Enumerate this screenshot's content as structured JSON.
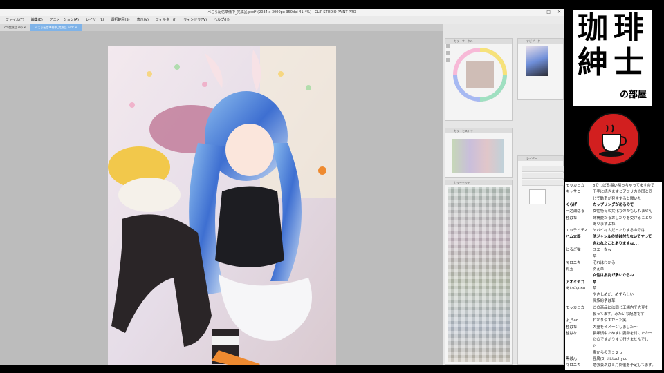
{
  "window": {
    "title": "ぺこら配信準備中_完成品.psd* (2034 x 3000px 350dpi 41.4%) - CLIP STUDIO PAINT PRO",
    "controls": [
      "—",
      "□",
      "✕"
    ]
  },
  "menu": [
    "ファイル(F)",
    "編集(E)",
    "アニメーション(A)",
    "レイヤー(L)",
    "選択範囲(S)",
    "表示(V)",
    "フィルター(I)",
    "ウィンドウ(W)",
    "ヘルプ(H)"
  ],
  "tabs": [
    {
      "label": "ccli完成品.clip ✕",
      "active": false
    },
    {
      "label": "ぺこら配信準備中_完成品.psd* ✕",
      "active": true
    }
  ],
  "panels": {
    "color_wheel": "カラーサークル",
    "palette": "カラーセット",
    "history": "カラーヒストリー",
    "navigator": "ナビゲーター",
    "layers": "レイヤー"
  },
  "colors": {
    "badge": "#d21f1f",
    "accent_tab": "#7fb3e8",
    "chat_bg": "#ffffff"
  },
  "sidebar": {
    "logo_chars": [
      "珈",
      "琲",
      "紳",
      "士"
    ],
    "logo_sub": "の部屋"
  },
  "chat": [
    {
      "user": "モッカヨカ",
      "msg": "8でしぼる場い帰っちゃってますので",
      "bold": false
    },
    {
      "user": "キャサコ",
      "msg": "下手に続きますとアフリカの国と同",
      "bold": false
    },
    {
      "user": "",
      "msg": "じで勧奇が発生すると聞いた",
      "bold": false
    },
    {
      "user": "くらげ",
      "msg": "カップリングがあるので",
      "bold": true
    },
    {
      "user": "一之瀬はる",
      "msg": "女性特有の文化なのかもしれません",
      "bold": false
    },
    {
      "user": "桂はな",
      "msg": "姉構愛がるおしかりを受けることが",
      "bold": false
    },
    {
      "user": "",
      "msg": "ありますよね",
      "bold": false
    },
    {
      "user": "エッチビデオ",
      "msg": "ヤバイ村人だったりするのでは",
      "bold": false
    },
    {
      "user": "ハム太郎",
      "msg": "他ジャンルの姉は付たないですって",
      "bold": true
    },
    {
      "user": "",
      "msg": "言われたことありますね．．．",
      "bold": true
    },
    {
      "user": "とるご猫",
      "msg": "ユエーなｗ",
      "bold": false
    },
    {
      "user": "",
      "msg": "草",
      "bold": false
    },
    {
      "user": "マロニキ",
      "msg": "それはわかる",
      "bold": false
    },
    {
      "user": "彩玉",
      "msg": "例え草",
      "bold": false
    },
    {
      "user": "",
      "msg": "女性は批判が多いからね",
      "bold": true
    },
    {
      "user": "アオミヤコ",
      "msg": "草",
      "bold": true
    },
    {
      "user": "あいの/i-no",
      "msg": "草",
      "bold": false
    },
    {
      "user": "",
      "msg": "やさしめだ、めずらしい",
      "bold": false
    },
    {
      "user": "",
      "msg": "民族紛争は草",
      "bold": false
    },
    {
      "user": "モッカヨカ",
      "msg": "この商品には同じ工場内で大豆を",
      "bold": false
    },
    {
      "user": "",
      "msg": "扱ってます、みたいな配慮です",
      "bold": false
    },
    {
      "user": "ょ_Sao",
      "msg": "わかりやすかった笑",
      "bold": false
    },
    {
      "user": "桂はな",
      "msg": "大量をイメージしました～",
      "bold": false
    },
    {
      "user": "桂はな",
      "msg": "長年慣中ためすに姿勢を付けたかっ",
      "bold": false
    },
    {
      "user": "",
      "msg": "たのですがうまく行きませんでし",
      "bold": false
    },
    {
      "user": "",
      "msg": "た．．",
      "bold": false
    },
    {
      "user": "",
      "msg": "霊からの光３２ｐ",
      "bold": false
    },
    {
      "user": "黒ぱん",
      "msg": "豆腐(3)  ttt.touhyou",
      "bold": false
    },
    {
      "user": "マロニキ",
      "msg": "勉強会次は８月関催を予定してます。",
      "bold": false
    }
  ]
}
